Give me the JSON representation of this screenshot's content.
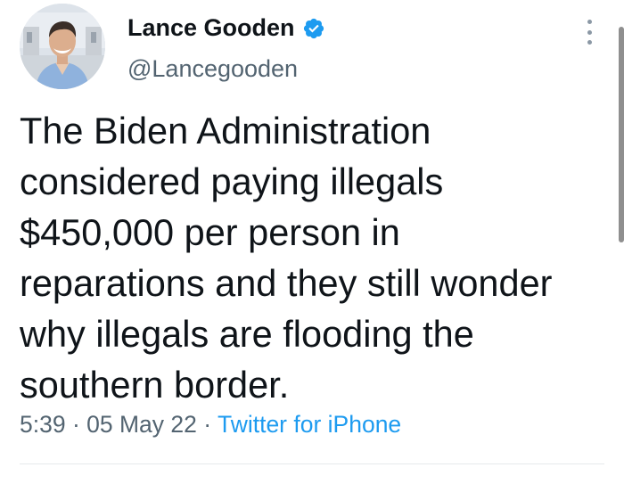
{
  "author": {
    "display_name": "Lance Gooden",
    "handle": "@Lancegooden",
    "verified": true
  },
  "tweet": {
    "text": "The Biden Administration\nconsidered paying illegals\n$450,000 per person in\nreparations and they still wonder\nwhy illegals are flooding the\nsouthern border.",
    "time": "5:39",
    "separator": " · ",
    "date": "05 May 22",
    "source": "Twitter for iPhone"
  },
  "icons": {
    "verified": "verified-badge-icon",
    "more": "more-options-icon"
  },
  "colors": {
    "text": "#0f1419",
    "secondary": "#536471",
    "link": "#1d9bf0",
    "verified": "#1d9bf0"
  }
}
